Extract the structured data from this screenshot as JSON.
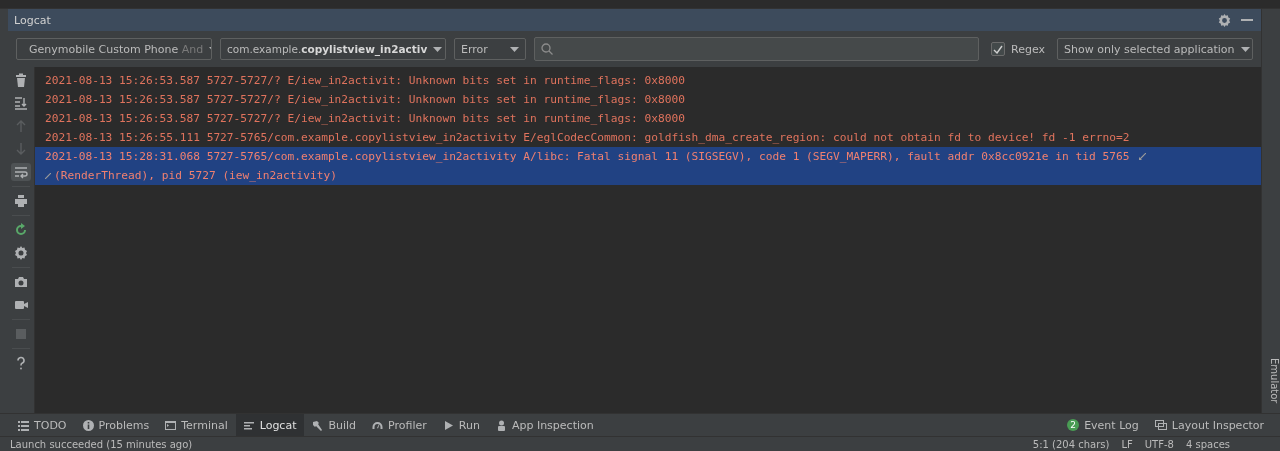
{
  "panel": {
    "title": "Logcat"
  },
  "toolbar": {
    "device": {
      "name": "Genymobile Custom Phone",
      "suffix": "And"
    },
    "process": {
      "prefix": "com.example.",
      "bold": "copylistview_in2activ"
    },
    "level": "Error",
    "regex": {
      "label": "Regex",
      "checked": true
    },
    "filter": "Show only selected application"
  },
  "side_tools": [
    {
      "kind": "trash",
      "disabled": false,
      "on": false
    },
    {
      "kind": "scroll-end",
      "disabled": false,
      "on": false
    },
    {
      "kind": "up",
      "disabled": true,
      "on": false
    },
    {
      "kind": "down",
      "disabled": true,
      "on": false
    },
    {
      "kind": "wrap",
      "disabled": false,
      "on": true
    },
    {
      "kind": "print",
      "disabled": false,
      "on": false
    },
    {
      "kind": "restart",
      "disabled": false,
      "on": false
    },
    {
      "kind": "gear",
      "disabled": false,
      "on": false
    },
    {
      "kind": "camera",
      "disabled": false,
      "on": false
    },
    {
      "kind": "video",
      "disabled": false,
      "on": false
    },
    {
      "kind": "stop",
      "disabled": true,
      "on": false
    },
    {
      "kind": "help",
      "disabled": false,
      "on": false
    }
  ],
  "log": [
    {
      "text": "2021-08-13 15:26:53.587 5727-5727/? E/iew_in2activit: Unknown bits set in runtime_flags: 0x8000",
      "selected": false
    },
    {
      "text": "2021-08-13 15:26:53.587 5727-5727/? E/iew_in2activit: Unknown bits set in runtime_flags: 0x8000",
      "selected": false
    },
    {
      "text": "2021-08-13 15:26:53.587 5727-5727/? E/iew_in2activit: Unknown bits set in runtime_flags: 0x8000",
      "selected": false
    },
    {
      "text": "2021-08-13 15:26:55.111 5727-5765/com.example.copylistview_in2activity E/eglCodecCommon: goldfish_dma_create_region: could not obtain fd to device! fd -1 errno=2",
      "selected": false
    },
    {
      "text": "2021-08-13 15:28:31.068 5727-5765/com.example.copylistview_in2activity A/libc: Fatal signal 11 (SIGSEGV), code 1 (SEGV_MAPERR), fault addr 0x8cc0921e in tid 5765",
      "wrap": "(RenderThread), pid 5727 (iew_in2activity)",
      "selected": true
    }
  ],
  "right_tools": [
    {
      "label": "Emulator"
    }
  ],
  "bottom_tabs": [
    {
      "label": "TODO",
      "selected": false
    },
    {
      "label": "Problems",
      "selected": false
    },
    {
      "label": "Terminal",
      "selected": false
    },
    {
      "label": "Logcat",
      "selected": true
    },
    {
      "label": "Build",
      "selected": false
    },
    {
      "label": "Profiler",
      "selected": false
    },
    {
      "label": "Run",
      "selected": false
    },
    {
      "label": "App Inspection",
      "selected": false
    }
  ],
  "bottom_right": [
    {
      "label": "Event Log",
      "badge": "2"
    },
    {
      "label": "Layout Inspector"
    }
  ],
  "status_bar": {
    "message": "Launch succeeded (15 minutes ago)",
    "items": [
      "5:1 (204 chars)",
      "LF",
      "UTF-8",
      "4 spaces"
    ]
  }
}
